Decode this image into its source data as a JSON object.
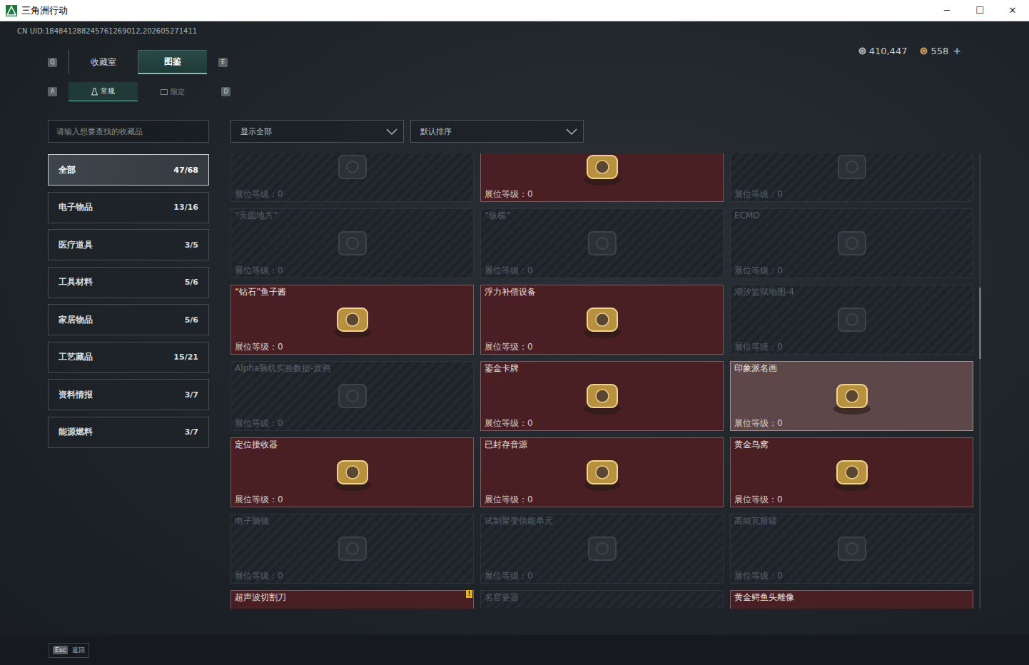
{
  "window": {
    "title": "三角洲行动",
    "controls": [
      "─",
      "☐",
      "✕"
    ]
  },
  "uid": "CN UID:184841288245761269012,202605271411",
  "currencies": [
    {
      "value": "410,447",
      "color": "#a7b0b6"
    },
    {
      "value": "558",
      "color": "#c99a5a"
    }
  ],
  "currency_add": "+",
  "tabs": {
    "prev_key": "Q",
    "next_key": "E",
    "items": [
      {
        "label": "收藏室",
        "selected": false
      },
      {
        "label": "图鉴",
        "selected": true
      }
    ]
  },
  "subtabs": {
    "prev_key": "A",
    "next_key": "D",
    "items": [
      {
        "label": "常规",
        "selected": true
      },
      {
        "label": "限定",
        "selected": false
      }
    ]
  },
  "search": {
    "placeholder": "请输入想要查找的收藏品"
  },
  "filters": [
    {
      "label": "显示全部"
    },
    {
      "label": "默认排序"
    }
  ],
  "sidebar": {
    "items": [
      {
        "label": "全部",
        "count": "47/68",
        "selected": true
      },
      {
        "label": "电子物品",
        "count": "13/16",
        "selected": false
      },
      {
        "label": "医疗道具",
        "count": "3/5",
        "selected": false
      },
      {
        "label": "工具材料",
        "count": "5/6",
        "selected": false
      },
      {
        "label": "家居物品",
        "count": "5/6",
        "selected": false
      },
      {
        "label": "工艺藏品",
        "count": "15/21",
        "selected": false
      },
      {
        "label": "资料情报",
        "count": "3/7",
        "selected": false
      },
      {
        "label": "能源燃料",
        "count": "3/7",
        "selected": false
      }
    ]
  },
  "items": [
    {
      "name": "",
      "level": "展位等级：0",
      "collected": false,
      "hovered": false,
      "badge": ""
    },
    {
      "name": "",
      "level": "展位等级：0",
      "collected": true,
      "hovered": false,
      "badge": ""
    },
    {
      "name": "",
      "level": "展位等级：0",
      "collected": false,
      "hovered": false,
      "badge": ""
    },
    {
      "name": "“天圆地方”",
      "level": "展位等级：0",
      "collected": false,
      "hovered": false,
      "badge": ""
    },
    {
      "name": "“纵横”",
      "level": "展位等级：0",
      "collected": false,
      "hovered": false,
      "badge": ""
    },
    {
      "name": "ECMO",
      "level": "展位等级：0",
      "collected": false,
      "hovered": false,
      "badge": ""
    },
    {
      "name": "“钻石”鱼子酱",
      "level": "展位等级：0",
      "collected": true,
      "hovered": false,
      "badge": ""
    },
    {
      "name": "浮力补偿设备",
      "level": "展位等级：0",
      "collected": true,
      "hovered": false,
      "badge": ""
    },
    {
      "name": "潮汐监狱地图-4",
      "level": "展位等级：0",
      "collected": false,
      "hovered": false,
      "badge": ""
    },
    {
      "name": "Alpha脑机实验数据-渡鸦",
      "level": "展位等级：0",
      "collected": false,
      "hovered": false,
      "badge": ""
    },
    {
      "name": "鎏金卡牌",
      "level": "展位等级：0",
      "collected": true,
      "hovered": false,
      "badge": ""
    },
    {
      "name": "印象派名画",
      "level": "展位等级：0",
      "collected": true,
      "hovered": true,
      "badge": ""
    },
    {
      "name": "定位接收器",
      "level": "展位等级：0",
      "collected": true,
      "hovered": false,
      "badge": ""
    },
    {
      "name": "已封存音源",
      "level": "展位等级：0",
      "collected": true,
      "hovered": false,
      "badge": ""
    },
    {
      "name": "黄金鸟窝",
      "level": "展位等级：0",
      "collected": true,
      "hovered": false,
      "badge": ""
    },
    {
      "name": "电子脑镜",
      "level": "展位等级：0",
      "collected": false,
      "hovered": false,
      "badge": ""
    },
    {
      "name": "试制聚变供能单元",
      "level": "展位等级：0",
      "collected": false,
      "hovered": false,
      "badge": ""
    },
    {
      "name": "高能瓦斯罐",
      "level": "展位等级：0",
      "collected": false,
      "hovered": false,
      "badge": ""
    },
    {
      "name": "超声波切割刀",
      "level": "",
      "collected": true,
      "hovered": false,
      "badge": "!"
    },
    {
      "name": "名窑瓷器",
      "level": "",
      "collected": false,
      "hovered": false,
      "badge": ""
    },
    {
      "name": "黄金鳄鱼头雕像",
      "level": "",
      "collected": true,
      "hovered": false,
      "badge": ""
    }
  ],
  "footer": {
    "key": "Esc",
    "label": "返回"
  }
}
